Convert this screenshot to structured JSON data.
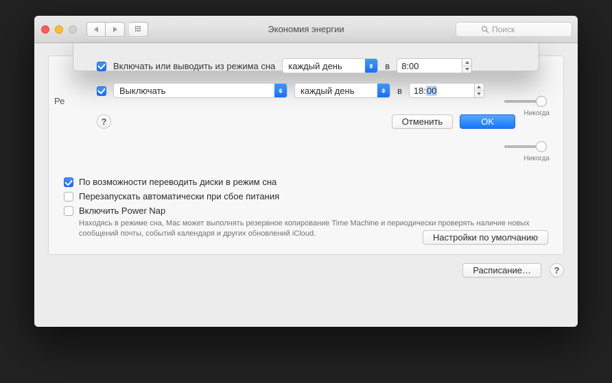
{
  "window": {
    "title": "Экономия энергии",
    "search_placeholder": "Поиск",
    "never_label": "Никогда"
  },
  "sheet": {
    "wake": {
      "checked": true,
      "label": "Включать или выводить из режима сна",
      "frequency": "каждый день",
      "at": "в",
      "time": "8:00"
    },
    "shutdown": {
      "checked": true,
      "action": "Выключать",
      "frequency": "каждый день",
      "at": "в",
      "time_h": "18:",
      "time_m_sel": "00"
    },
    "cancel": "Отменить",
    "ok": "OK"
  },
  "options": {
    "disk_sleep": {
      "checked": true,
      "label": "По возможности переводить диски в режим сна"
    },
    "restart_fail": {
      "checked": false,
      "label": "Перезапускать автоматически при сбое питания"
    },
    "power_nap": {
      "checked": false,
      "label": "Включить Power Nap",
      "hint": "Находясь в режиме сна, Mac может выполнять резервное копирование Time Machine и периодически проверять наличие новых сообщений почты, событий календаря и других обновлений iCloud."
    }
  },
  "buttons": {
    "defaults": "Настройки по умолчанию",
    "schedule": "Расписание…"
  },
  "partial": {
    "left_label": "Ре"
  }
}
